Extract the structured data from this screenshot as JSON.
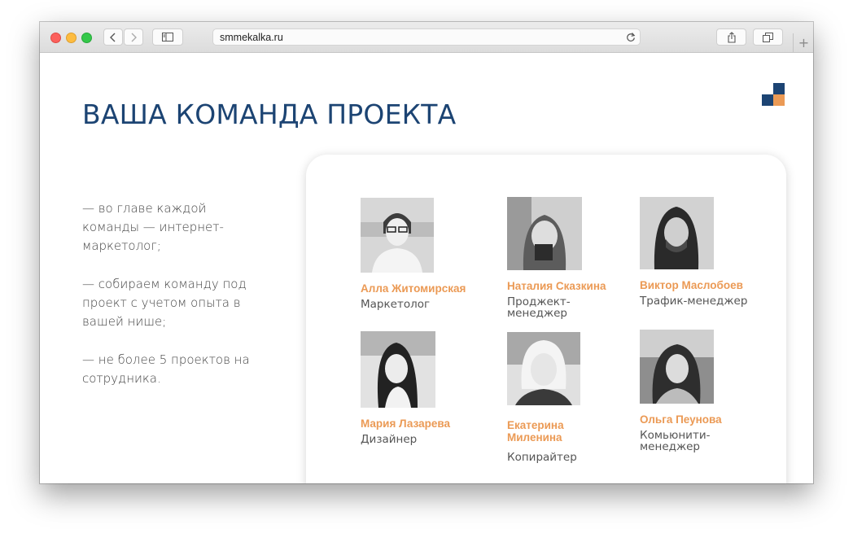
{
  "browser": {
    "url": "smmekalka.ru"
  },
  "page": {
    "title": "ВАША КОМАНДА ПРОЕКТА",
    "bullets": [
      "— во главе каждой команды — интернет-маркетолог;",
      "— собираем команду под проект с учетом опыта в вашей нише;",
      "— не более 5 проектов на сотрудника."
    ]
  },
  "team": [
    {
      "name": "Алла Житомирская",
      "role": "Маркетолог"
    },
    {
      "name": "Наталия Сказкина",
      "role": "Проджект-менеджер"
    },
    {
      "name": "Виктор Маслобоев",
      "role": "Трафик-менеджер"
    },
    {
      "name": "Мария Лазарева",
      "role": "Дизайнер"
    },
    {
      "name": "Екатерина Миленина",
      "role": "Копирайтер"
    },
    {
      "name": "Ольга Пеунова",
      "role": "Комьюнити-менеджер"
    }
  ],
  "colors": {
    "title": "#1c4473",
    "name_accent": "#eb9a55",
    "logo_dark": "#1c4473",
    "logo_orange": "#eb9a55"
  },
  "icons": {
    "back": "chevron-left-icon",
    "forward": "chevron-right-icon",
    "sidebar": "sidebar-icon",
    "reload": "reload-icon",
    "share": "share-icon",
    "tabs": "tabs-icon",
    "new_tab": "plus-icon"
  }
}
